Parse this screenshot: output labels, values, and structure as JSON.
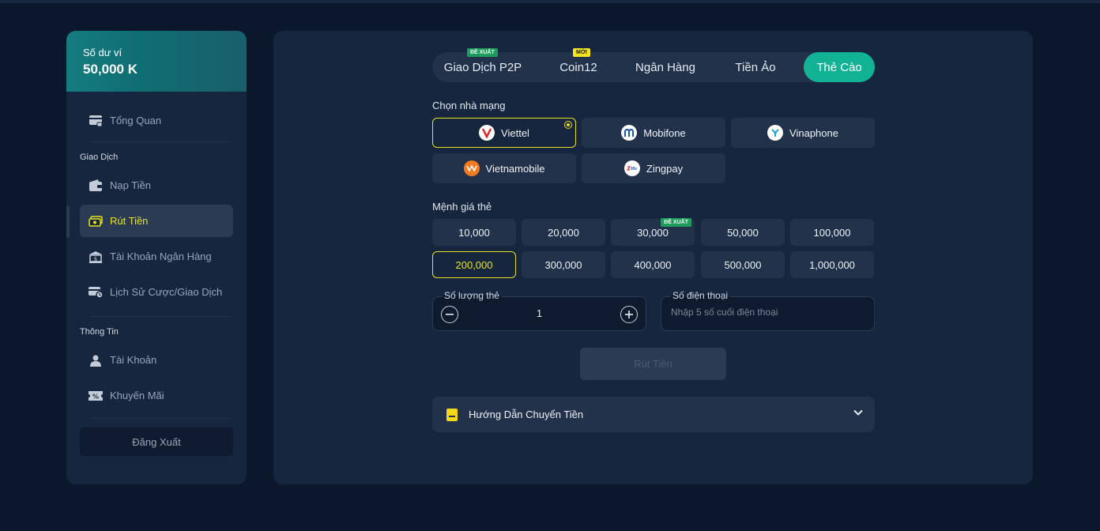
{
  "sidebar": {
    "balance_label": "Số dư ví",
    "balance_value": "50,000 K",
    "overview": "Tổng Quan",
    "section_transactions": "Giao Dịch",
    "deposit": "Nạp Tiền",
    "withdraw": "Rút Tiền",
    "bank_account": "Tài Khoản Ngân Hàng",
    "history": "Lịch Sử Cược/Giao Dịch",
    "section_info": "Thông Tin",
    "account": "Tài Khoản",
    "promotion": "Khuyến Mãi",
    "logout": "Đăng Xuất"
  },
  "tabs": {
    "p2p": "Giao Dịch P2P",
    "p2p_badge": "ĐỀ XUẤT",
    "coin12": "Coin12",
    "coin12_badge": "MỚI",
    "bank": "Ngân Hàng",
    "crypto": "Tiền Ảo",
    "card": "Thẻ Cào"
  },
  "providers": {
    "label": "Chọn nhà mạng",
    "viettel": "Viettel",
    "mobifone": "Mobifone",
    "vinaphone": "Vinaphone",
    "vietnamobile": "Vietnamobile",
    "zingpay": "Zingpay"
  },
  "amounts": {
    "label": "Mệnh giá thẻ",
    "a10": "10,000",
    "a20": "20,000",
    "a30": "30,000",
    "a30_badge": "ĐỀ XUẤT",
    "a50": "50,000",
    "a100": "100,000",
    "a200": "200,000",
    "a300": "300,000",
    "a400": "400,000",
    "a500": "500,000",
    "a1000": "1,000,000"
  },
  "quantity": {
    "label": "Số lượng thẻ",
    "value": "1"
  },
  "phone": {
    "label": "Số điện thoại",
    "placeholder": "Nhập 5 số cuối điện thoại"
  },
  "submit": "Rút Tiền",
  "guide": "Hướng Dẫn Chuyển Tiền",
  "colors": {
    "accent_yellow": "#e9e11f",
    "accent_green": "#12b394",
    "panel": "#16263e",
    "background": "#0b182c"
  }
}
